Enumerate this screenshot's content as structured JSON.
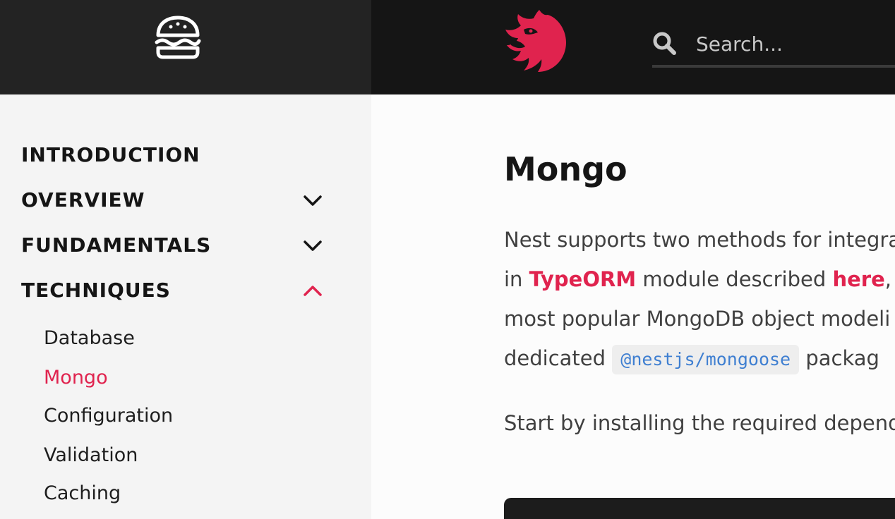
{
  "header": {
    "search_placeholder": "Search...",
    "menu_icon": "burger-icon",
    "logo_icon": "nestjs-cat-logo",
    "search_icon": "search-icon"
  },
  "sidebar": {
    "sections": [
      {
        "label": "INTRODUCTION",
        "chevron": "none"
      },
      {
        "label": "OVERVIEW",
        "chevron": "down"
      },
      {
        "label": "FUNDAMENTALS",
        "chevron": "down"
      },
      {
        "label": "TECHNIQUES",
        "chevron": "up"
      }
    ],
    "techniques_items": [
      {
        "label": "Database",
        "active": false
      },
      {
        "label": "Mongo",
        "active": true
      },
      {
        "label": "Configuration",
        "active": false
      },
      {
        "label": "Validation",
        "active": false
      },
      {
        "label": "Caching",
        "active": false
      }
    ]
  },
  "content": {
    "title": "Mongo",
    "p1": {
      "line1": "Nest supports two methods for integra",
      "line2_pre": "in ",
      "line2_link1": "TypeORM",
      "line2_mid": " module described ",
      "line2_link2": "here",
      "line2_post": ", w",
      "line3": "most popular MongoDB object modeli",
      "line4_pre": "dedicated ",
      "line4_code": "@nestjs/mongoose",
      "line4_post": " packag"
    },
    "p2": "Start by installing the required depend"
  },
  "colors": {
    "accent": "#e0234e",
    "header_bg": "#151515",
    "header_left_bg": "#232323",
    "sidebar_bg": "#f4f4f4",
    "code_text": "#3f7fd1"
  }
}
